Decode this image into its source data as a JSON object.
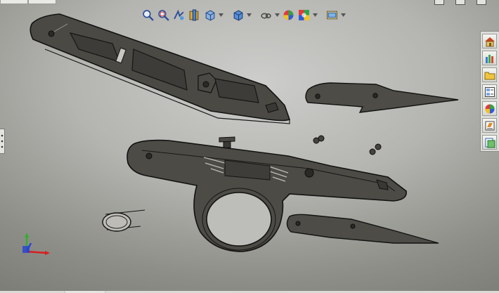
{
  "heads_up_toolbar": {
    "icons": [
      "zoom-to-fit-icon",
      "zoom-to-area-icon",
      "previous-view-icon",
      "section-view-icon",
      "view-orientation-icon",
      "display-style-icon",
      "hide-show-items-icon",
      "edit-appearance-icon",
      "apply-scene-icon",
      "view-settings-icon"
    ]
  },
  "task_pane": {
    "icons": [
      "home-icon",
      "design-library-icon",
      "file-explorer-icon",
      "view-palette-icon",
      "appearances-icon",
      "custom-properties-icon",
      "document-recovery-icon"
    ]
  },
  "triad": {
    "axes": [
      "Y",
      "X",
      "Z"
    ],
    "colors": {
      "y": "#2fb02f",
      "x": "#d81f1f",
      "z": "#2742d6"
    }
  },
  "colors": {
    "part_fill": "#4d4b45",
    "part_edge": "#141414",
    "viewport_center": "#cdcdcb",
    "viewport_edge": "#7a7a74"
  }
}
